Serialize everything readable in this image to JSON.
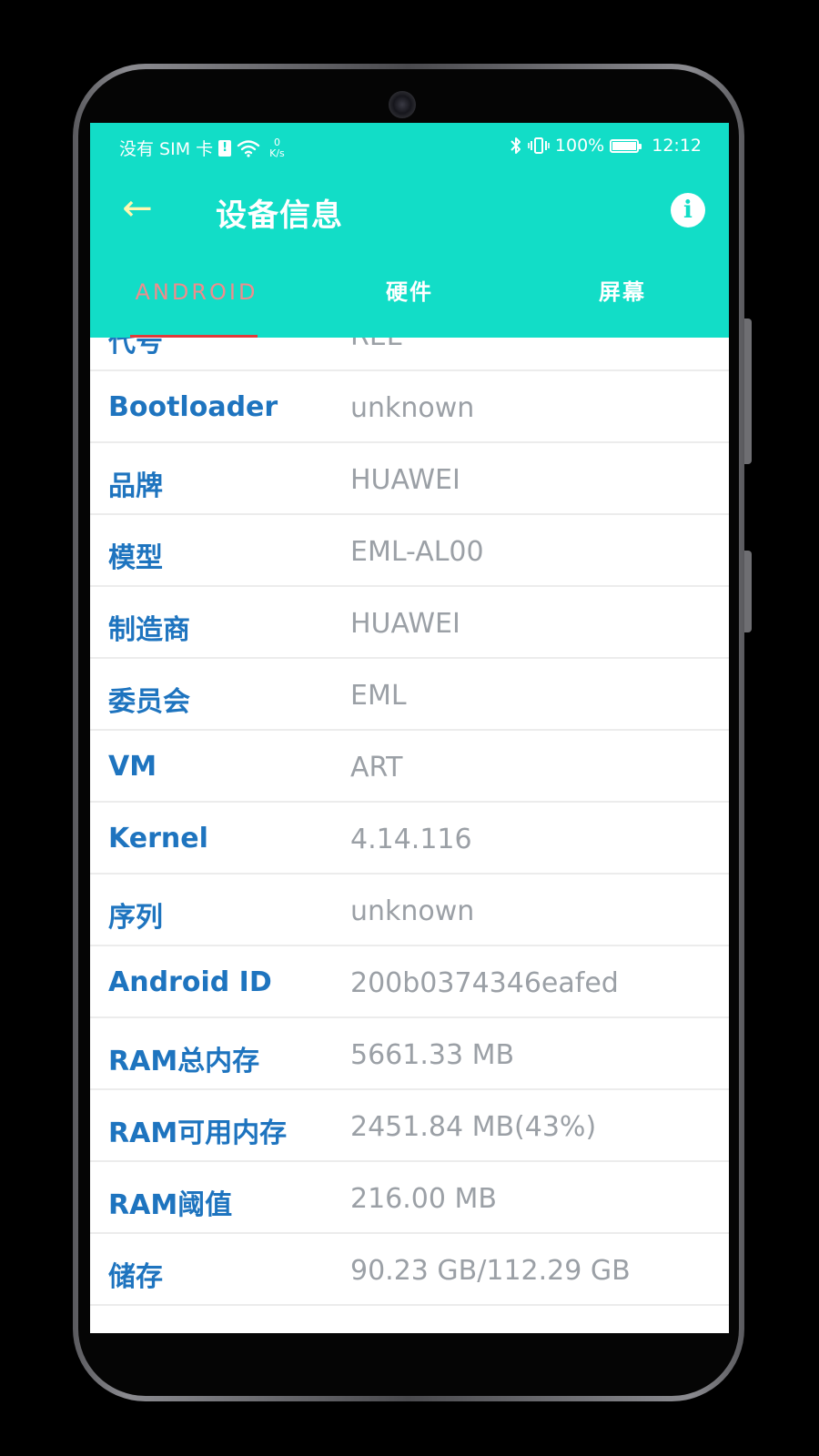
{
  "status_bar": {
    "carrier": "没有 SIM 卡",
    "sim_badge": "!",
    "net_speed_value": "0",
    "net_speed_unit": "K/s",
    "battery_percent": "100%",
    "battery_level": 1.0,
    "time": "12:12"
  },
  "toolbar": {
    "back_icon": "arrow-left-icon",
    "back_glyph": "←",
    "title": "设备信息",
    "info_icon": "info-icon",
    "info_glyph": "i"
  },
  "tabs": [
    {
      "label": "ANDROID",
      "active": true
    },
    {
      "label": "硬件",
      "active": false
    },
    {
      "label": "屏幕",
      "active": false
    }
  ],
  "rows": [
    {
      "label": "代号",
      "value": "REL"
    },
    {
      "label": "Bootloader",
      "value": "unknown"
    },
    {
      "label": "品牌",
      "value": "HUAWEI"
    },
    {
      "label": "模型",
      "value": "EML-AL00"
    },
    {
      "label": "制造商",
      "value": "HUAWEI"
    },
    {
      "label": "委员会",
      "value": "EML"
    },
    {
      "label": "VM",
      "value": "ART"
    },
    {
      "label": "Kernel",
      "value": "4.14.116"
    },
    {
      "label": "序列",
      "value": "unknown"
    },
    {
      "label": "Android ID",
      "value": "200b0374346eafed"
    },
    {
      "label": "RAM总内存",
      "value": "5661.33 MB"
    },
    {
      "label": "RAM可用内存",
      "value": "2451.84 MB(43%)"
    },
    {
      "label": "RAM阈值",
      "value": "216.00 MB"
    },
    {
      "label": "储存",
      "value": "90.23 GB/112.29 GB"
    }
  ],
  "colors": {
    "accent": "#12ddc7",
    "label": "#1e74bf",
    "value": "#9ba0a6",
    "tab_active": "#ef8c8c",
    "tab_indicator": "#e03a3a"
  }
}
